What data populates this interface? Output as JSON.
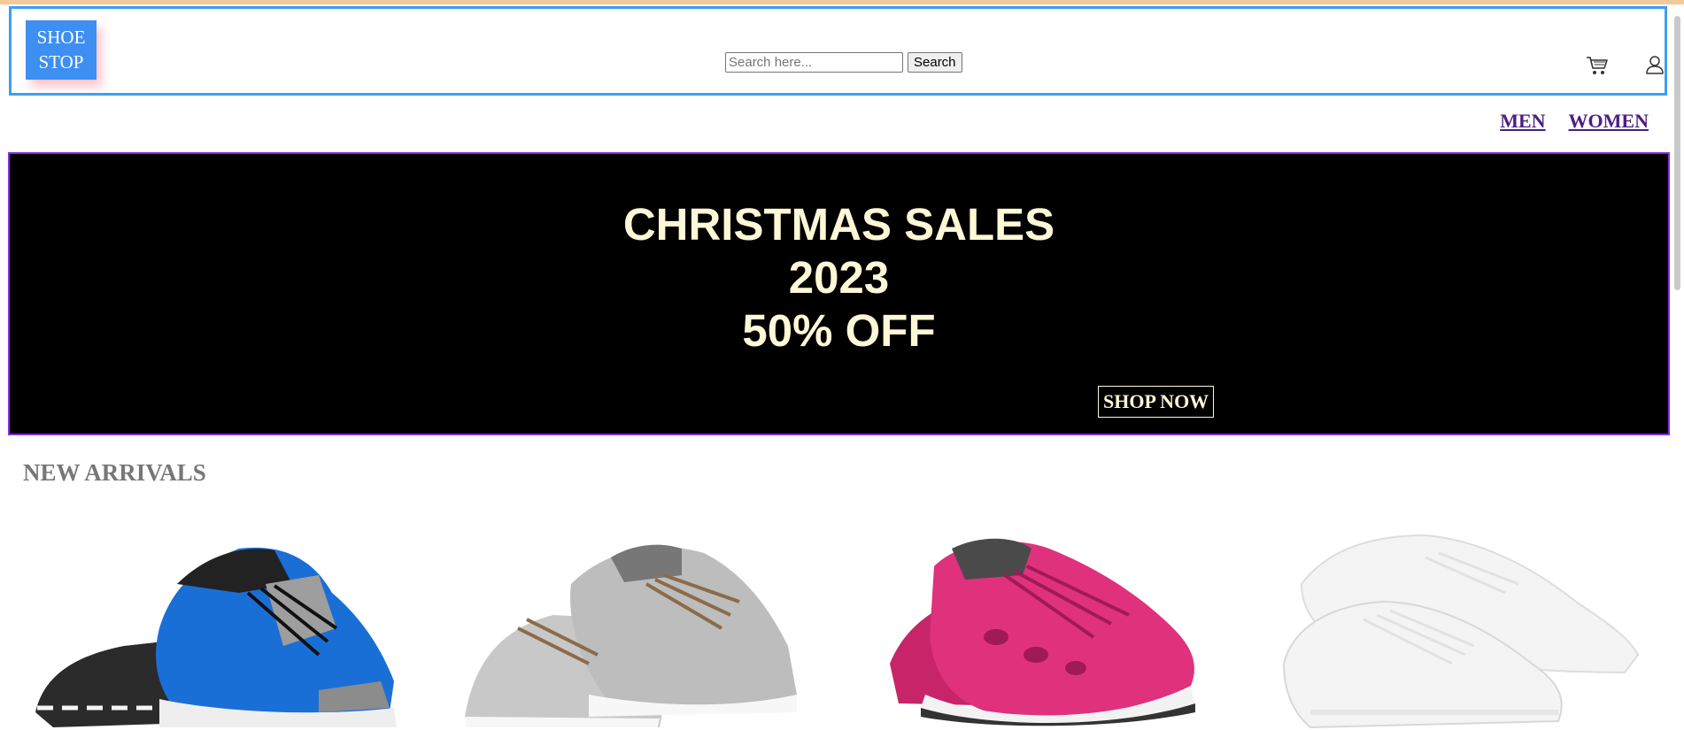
{
  "logo": {
    "line1": "SHOE",
    "line2": "STOP"
  },
  "search": {
    "placeholder": "Search here...",
    "button_label": "Search"
  },
  "header_icons": {
    "cart": "cart-icon",
    "user": "user-icon"
  },
  "nav": {
    "men": "MEN",
    "women": "WOMEN"
  },
  "banner": {
    "line1": "CHRISTMAS SALES",
    "line2": "2023",
    "line3": "50% OFF",
    "cta": "SHOP NOW"
  },
  "new_arrivals": {
    "title": "NEW ARRIVALS",
    "products": [
      {
        "color": "#1a6fd6"
      },
      {
        "color": "#bdbdbd"
      },
      {
        "color": "#e0317d"
      },
      {
        "color": "#f2f2f2"
      }
    ]
  },
  "colors": {
    "header_border": "#3ba0f0",
    "logo_bg": "#3d8ff2",
    "nav_link": "#4b1e85",
    "banner_bg": "#000000",
    "banner_border": "#8a2be2",
    "banner_text": "#fff7d6",
    "section_title": "#777777"
  }
}
